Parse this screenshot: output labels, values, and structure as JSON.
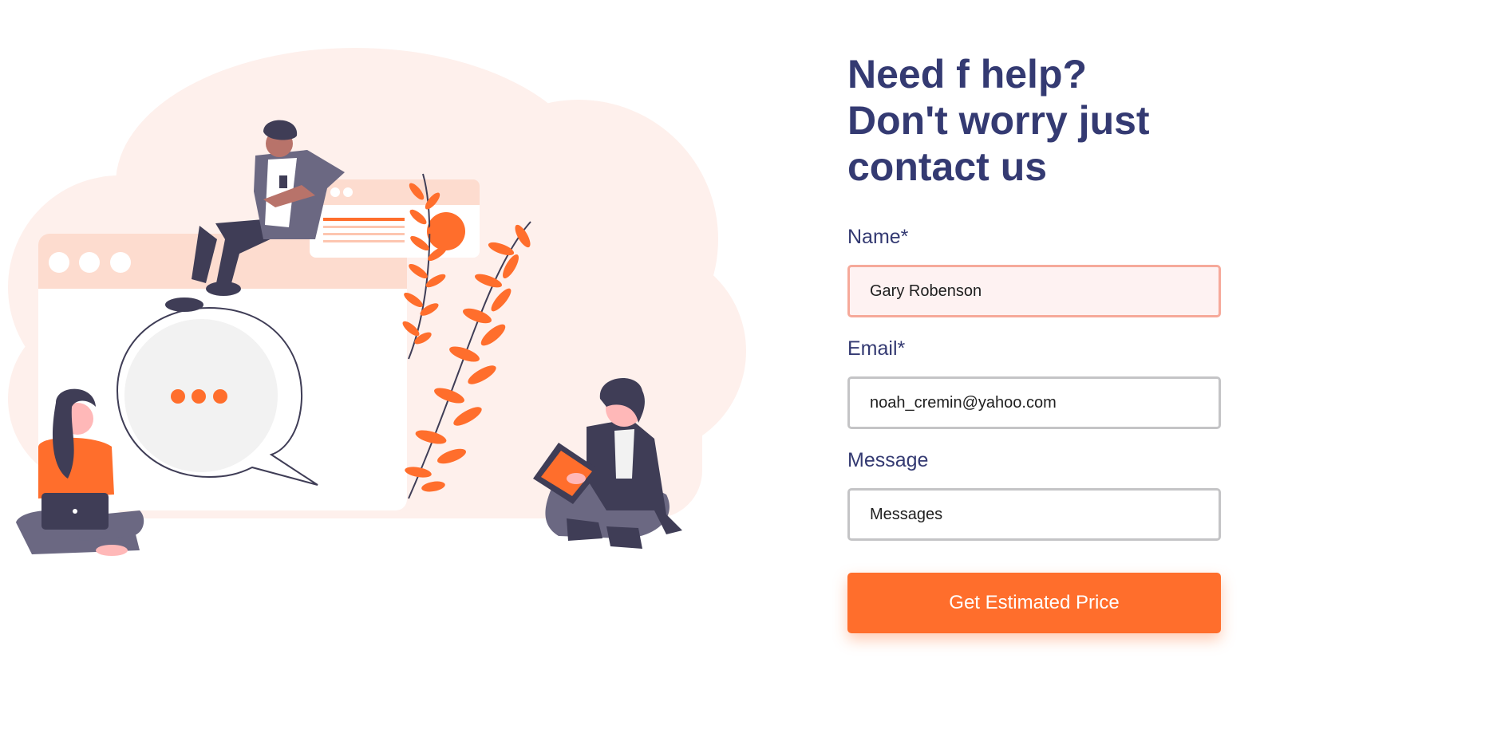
{
  "headline": {
    "line1": "Need f help?",
    "line2": "Don't worry just",
    "line3": "contact us"
  },
  "form": {
    "name": {
      "label": "Name*",
      "value": "Gary Robenson"
    },
    "email": {
      "label": "Email*",
      "value": "noah_cremin@yahoo.com"
    },
    "message": {
      "label": "Message",
      "placeholder": "Messages"
    },
    "submit_label": "Get Estimated Price"
  },
  "colors": {
    "accent": "#ff6e2c",
    "heading": "#343a72",
    "blob": "#fef0ec",
    "dark": "#3f3d56"
  },
  "illustration": {
    "icon": "people-chatting-illustration"
  }
}
